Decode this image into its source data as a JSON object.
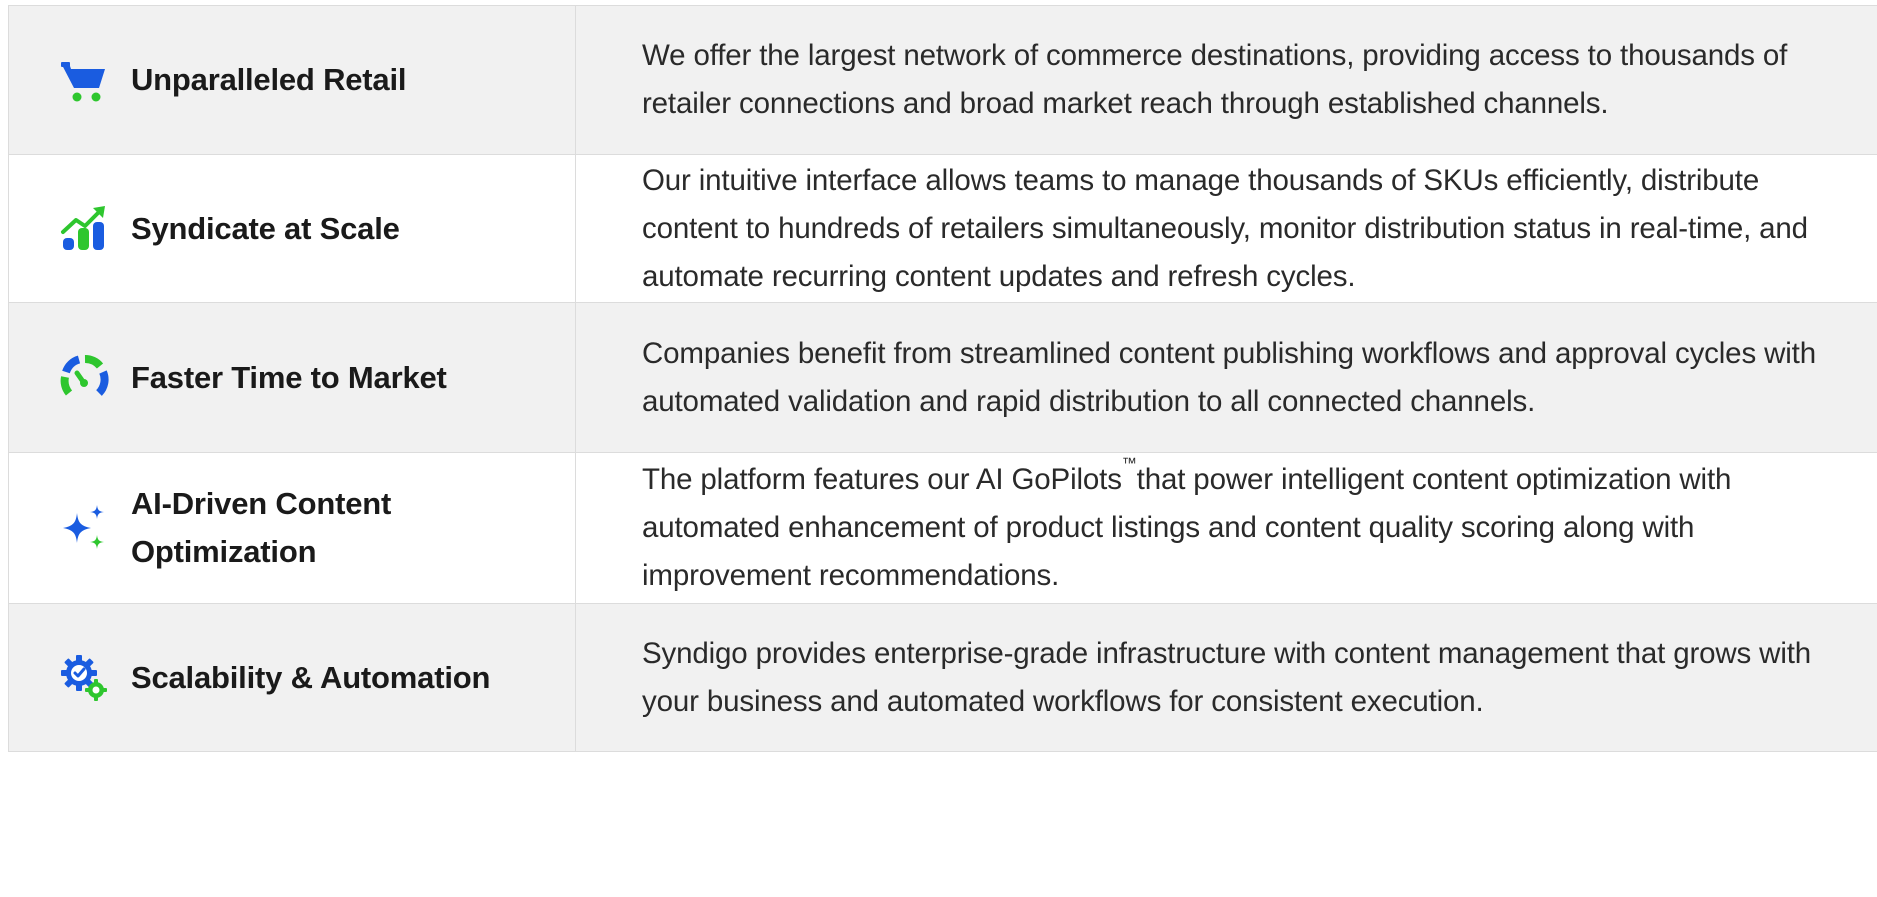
{
  "features": {
    "rows": [
      {
        "title": "Unparalleled Retail",
        "description": "We offer the largest network of commerce destinations, providing access to thousands of retailer connections and broad market reach through established channels.",
        "icon": "shopping-cart-icon"
      },
      {
        "title": "Syndicate at Scale",
        "description": "Our intuitive interface allows teams to manage thousands of SKUs efficiently, distribute content to hundreds of retailers simultaneously, monitor distribution status in real-time, and automate recurring content updates and refresh cycles.",
        "icon": "growth-chart-icon"
      },
      {
        "title": "Faster Time to Market",
        "description": "Companies benefit from streamlined content publishing workflows and approval cycles with automated validation and rapid distribution to all connected channels.",
        "icon": "speedometer-icon"
      },
      {
        "title": "AI-Driven Content Optimization",
        "description_before": "The platform features our AI GoPilots",
        "trademark": "™",
        "description_after": "that power intelligent content optimization with automated enhancement of product listings and content quality scoring along with improvement recommendations.",
        "icon": "ai-sparkle-icon"
      },
      {
        "title": "Scalability & Automation",
        "description": "Syndigo provides enterprise-grade infrastructure with content management that grows with your business and automated workflows for consistent execution.",
        "icon": "gears-icon"
      }
    ]
  },
  "colors": {
    "blue": "#1a5ce0",
    "green": "#2ec62e",
    "row_shaded": "#f1f1f1",
    "row_plain": "#ffffff",
    "border": "#dcdcdc"
  }
}
